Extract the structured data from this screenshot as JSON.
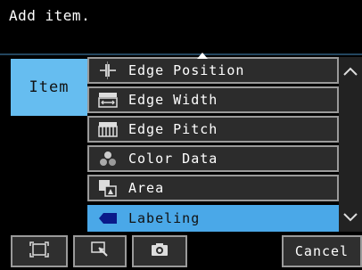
{
  "header": {
    "prompt": "Add item."
  },
  "sidebar": {
    "tab_label": "Item"
  },
  "list": {
    "items": [
      {
        "label": "Edge Position",
        "icon": "edge-position-icon",
        "selected": false
      },
      {
        "label": "Edge Width",
        "icon": "edge-width-icon",
        "selected": false
      },
      {
        "label": "Edge Pitch",
        "icon": "edge-pitch-icon",
        "selected": false
      },
      {
        "label": "Color Data",
        "icon": "color-data-icon",
        "selected": false
      },
      {
        "label": "Area",
        "icon": "area-icon",
        "selected": false
      },
      {
        "label": "Labeling",
        "icon": "labeling-icon",
        "selected": true
      }
    ]
  },
  "scrollbar": {
    "up_icon": "chevron-up-icon",
    "down_icon": "chevron-down-icon"
  },
  "toolbar": {
    "buttons": [
      {
        "icon": "fit-screen-icon"
      },
      {
        "icon": "zoom-select-icon"
      },
      {
        "icon": "camera-icon"
      }
    ],
    "cancel_label": "Cancel"
  },
  "colors": {
    "accent": "#66bdf0",
    "selected_row": "#4aa8e8",
    "row_bg": "#2c2c2c",
    "row_border": "#9a9a9a",
    "background": "#000000"
  }
}
